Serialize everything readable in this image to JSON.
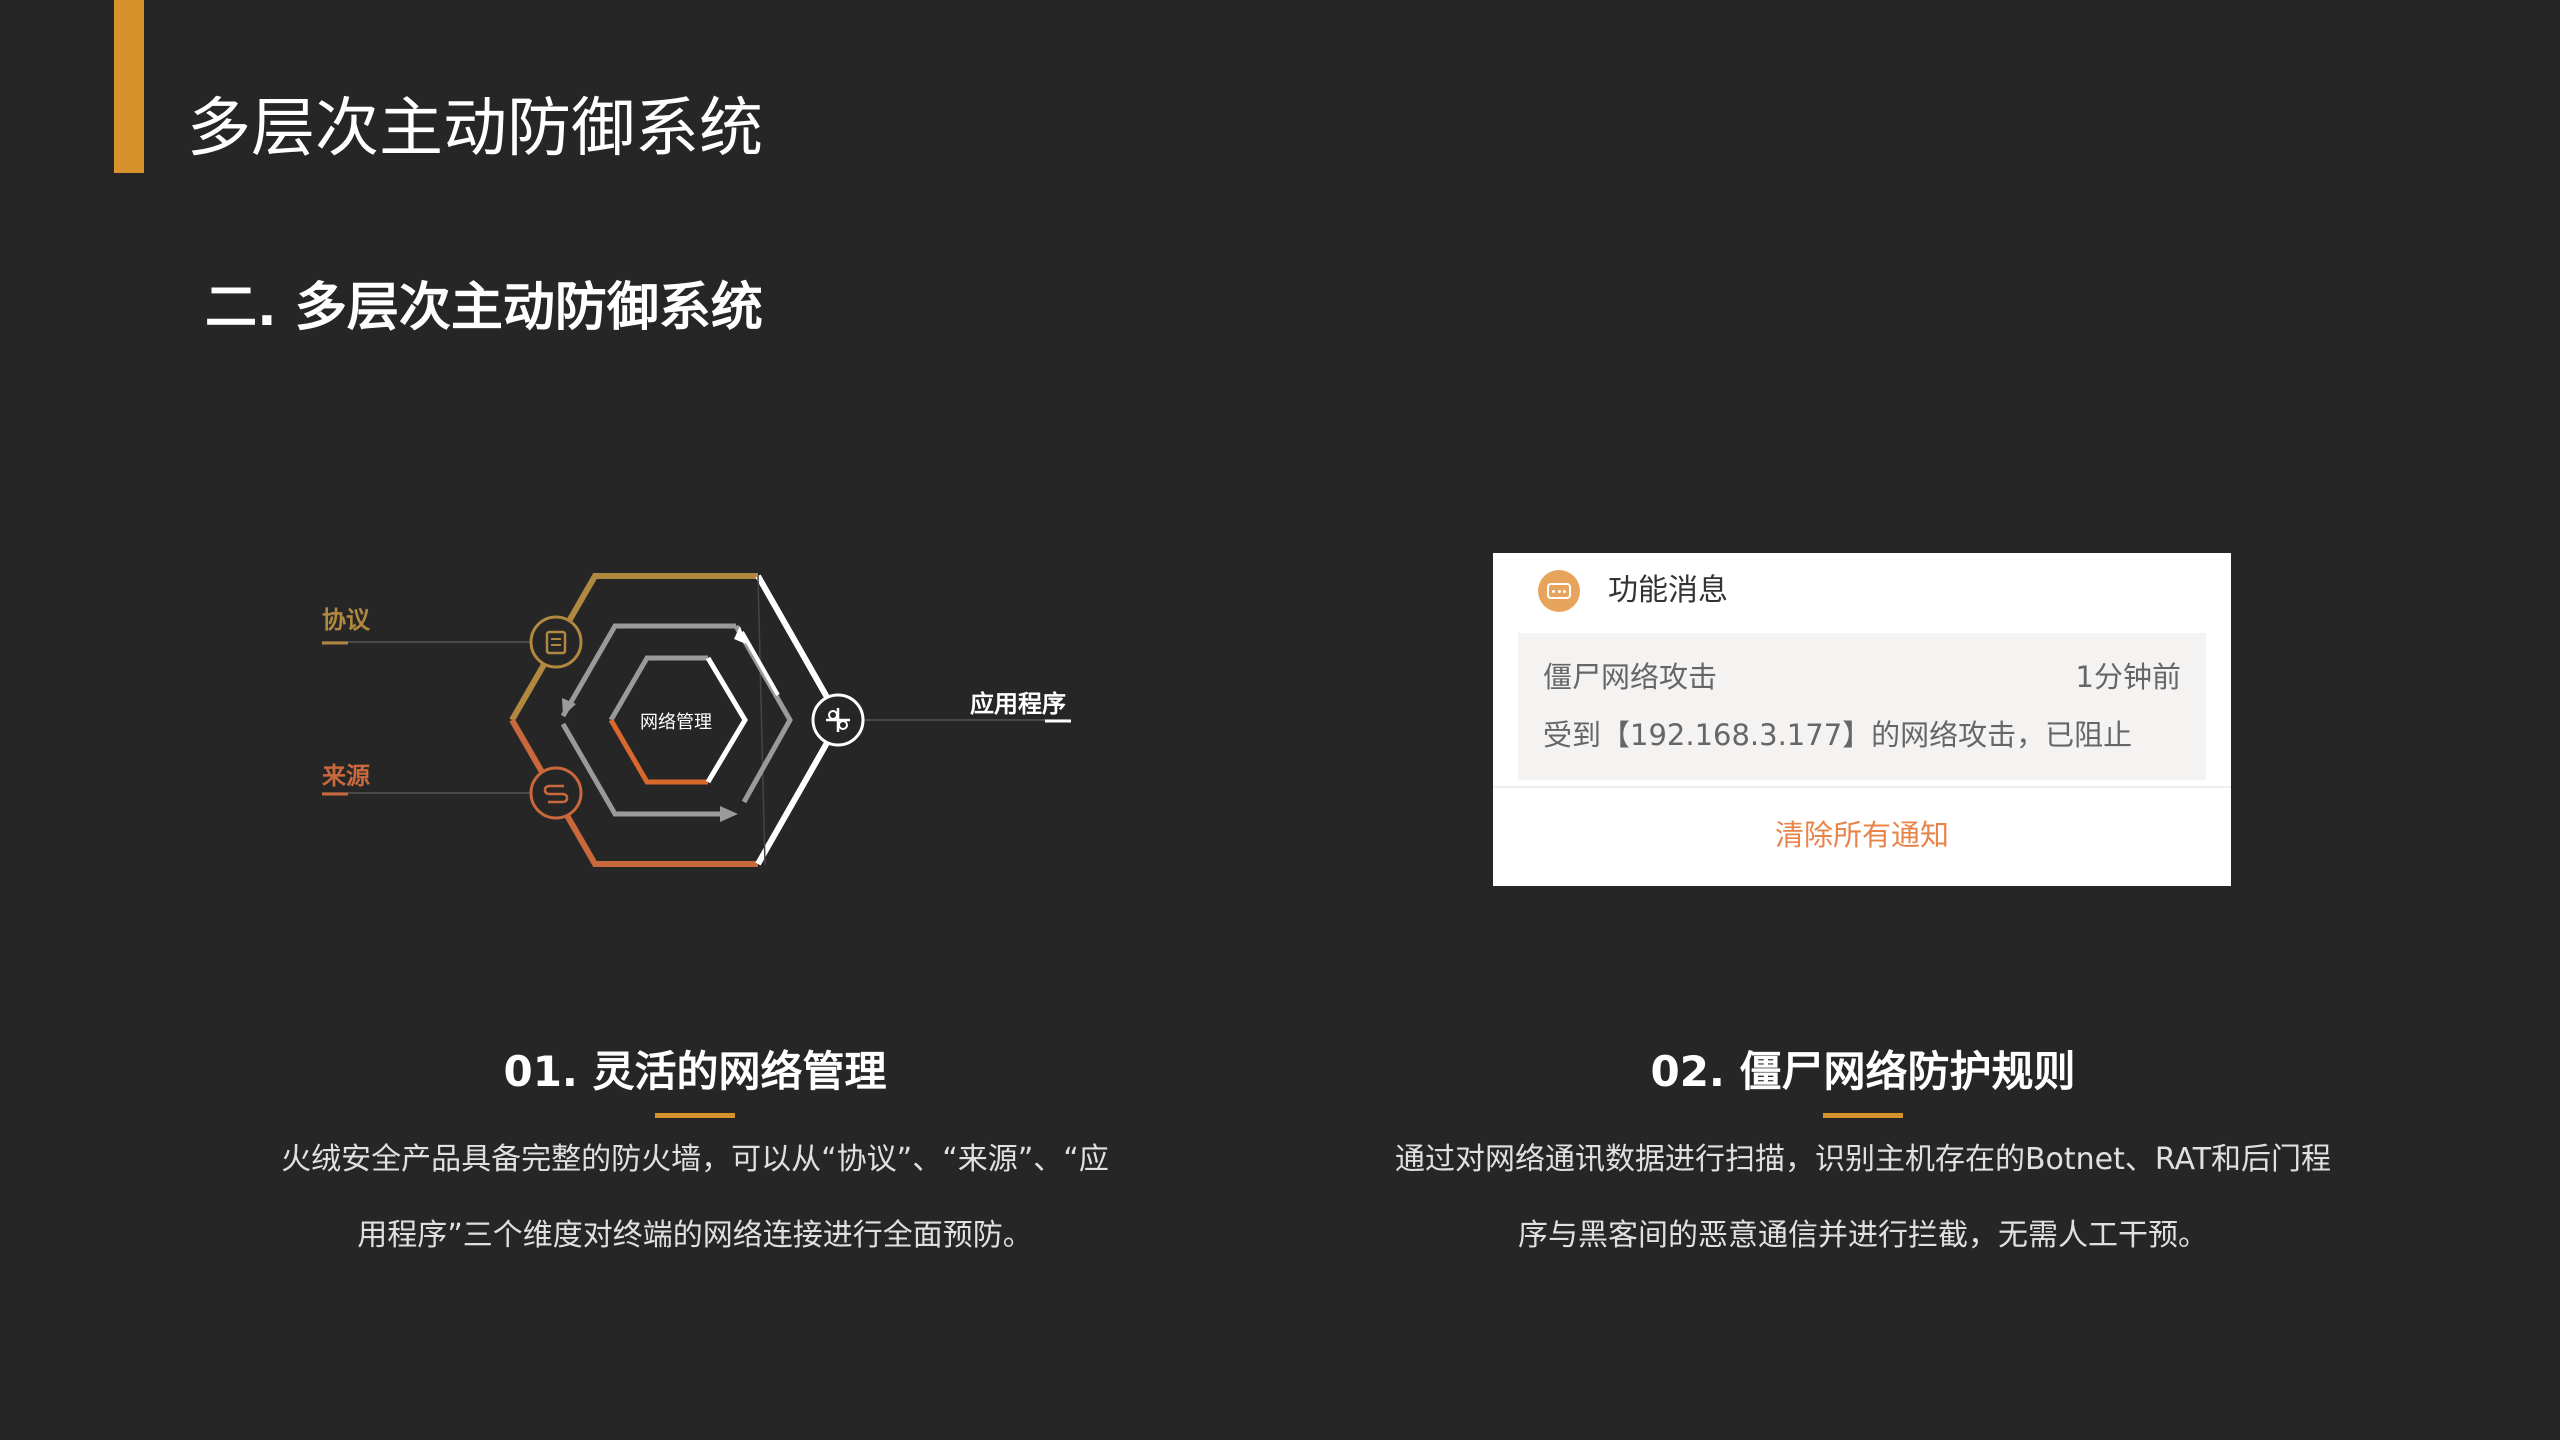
{
  "header": {
    "title": "多层次主动防御系统",
    "accent_color": "#d8922c"
  },
  "section": {
    "title": "二. 多层次主动防御系统"
  },
  "diagram": {
    "center_label": "网络管理",
    "label_protocol": "协议",
    "label_source": "来源",
    "label_application": "应用程序",
    "colors": {
      "protocol": "#b08840",
      "source": "#c8683c",
      "application": "#ffffff",
      "center": "#d8682c"
    },
    "icons": [
      "document-icon",
      "source-icon",
      "app-plus-icon"
    ]
  },
  "notification": {
    "header_title": "功能消息",
    "icon": "message-icon",
    "item": {
      "title": "僵尸网络攻击",
      "time": "1分钟前",
      "body": "受到【192.168.3.177】的网络攻击，已阻止"
    },
    "clear_label": "清除所有通知",
    "clear_color": "#e8844a"
  },
  "features": [
    {
      "title": "01. 灵活的网络管理",
      "desc_line1": "火绒安全产品具备完整的防火墙，可以从“协议”、“来源”、“应",
      "desc_line2": "用程序”三个维度对终端的网络连接进行全面预防。"
    },
    {
      "title": "02. 僵尸网络防护规则",
      "desc_line1": "通过对网络通讯数据进行扫描，识别主机存在的Botnet、RAT和后门程",
      "desc_line2": "序与黑客间的恶意通信并进行拦截，无需人工干预。"
    }
  ]
}
